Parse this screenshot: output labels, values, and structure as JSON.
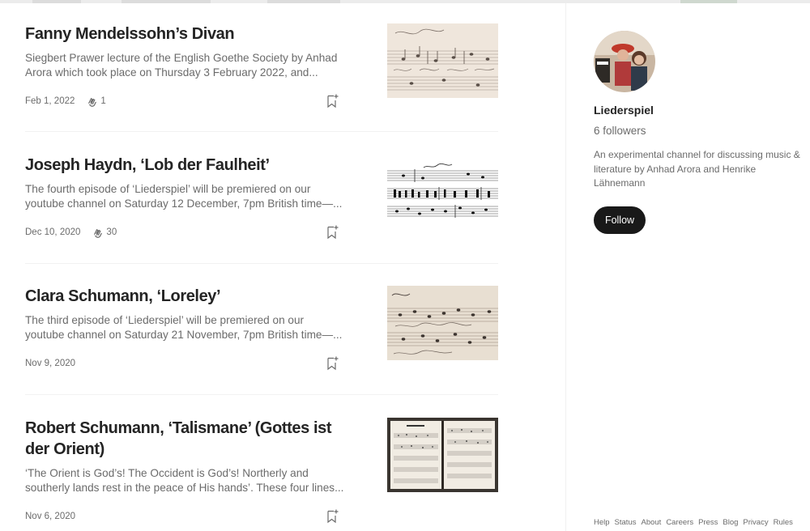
{
  "posts": [
    {
      "title": "Fanny Mendelssohn’s Divan",
      "excerpt": "Siegbert Prawer lecture of the English Goethe Society by Anhad Arora which took place on Thursday 3 February 2022, and...",
      "date": "Feb 1, 2022",
      "claps": "1",
      "thumbnail_icon": "manuscript-score-image"
    },
    {
      "title": "Joseph Haydn, ‘Lob der Faulheit’",
      "excerpt": "The fourth episode of ‘Liederspiel’ will be premiered on our youtube channel on Saturday 12 December, 7pm British time—...",
      "date": "Dec 10, 2020",
      "claps": "30",
      "thumbnail_icon": "printed-score-image"
    },
    {
      "title": "Clara Schumann, ‘Loreley’",
      "excerpt": "The third episode of ‘Liederspiel’ will be premiered on our youtube channel on Saturday 21 November, 7pm British time—...",
      "date": "Nov 9, 2020",
      "claps": "",
      "thumbnail_icon": "handwritten-score-image"
    },
    {
      "title": "Robert Schumann, ‘Talismane’ (Gottes ist der Orient)",
      "excerpt": "‘The Orient is God’s! The Occident is God’s! Northerly and southerly lands rest in the peace of His hands’. These four lines...",
      "date": "Nov 6, 2020",
      "claps": "",
      "thumbnail_icon": "open-score-book-image"
    }
  ],
  "sidebar": {
    "publication_name": "Liederspiel",
    "followers": "6 followers",
    "description": "An experimental channel for discussing music & literature by Anhad Arora and Henrike Lähnemann",
    "follow_label": "Follow"
  },
  "footer": {
    "links": [
      "Help",
      "Status",
      "About",
      "Careers",
      "Press",
      "Blog",
      "Privacy",
      "Rules"
    ]
  },
  "colors": {
    "text_primary": "#242424",
    "text_secondary": "#6b6b6b",
    "button_dark": "#191919"
  }
}
